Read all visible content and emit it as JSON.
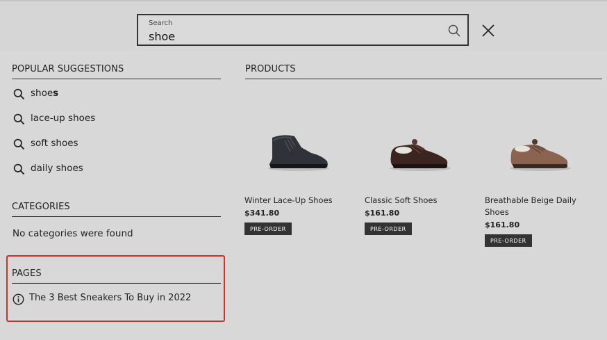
{
  "search": {
    "label": "Search",
    "value": "shoe"
  },
  "suggestions": {
    "title": "POPULAR SUGGESTIONS",
    "items": [
      {
        "prefix": "shoe",
        "suffix": "s"
      },
      {
        "prefix": "lace-up shoes",
        "suffix": ""
      },
      {
        "prefix": "soft shoes",
        "suffix": ""
      },
      {
        "prefix": "daily shoes",
        "suffix": ""
      }
    ]
  },
  "categories": {
    "title": "CATEGORIES",
    "empty_text": "No categories were found"
  },
  "pages": {
    "title": "PAGES",
    "items": [
      {
        "label": "The 3 Best Sneakers To Buy in 2022"
      }
    ],
    "highlight_color": "#d32f2f"
  },
  "products": {
    "title": "PRODUCTS",
    "items": [
      {
        "name": "Winter Lace-Up Shoes",
        "price": "$341.80",
        "badge": "PRE-ORDER",
        "image": "dark-lace-up-boot"
      },
      {
        "name": "Classic Soft Shoes",
        "price": "$161.80",
        "badge": "PRE-ORDER",
        "image": "brown-suede-oxford"
      },
      {
        "name": "Breathable Beige Daily Shoes",
        "price": "$161.80",
        "badge": "PRE-ORDER",
        "image": "tan-suede-derby"
      }
    ]
  },
  "icons": {
    "search": "search-icon",
    "close": "close-icon",
    "suggestion": "magnifier-icon",
    "page": "info-icon"
  }
}
